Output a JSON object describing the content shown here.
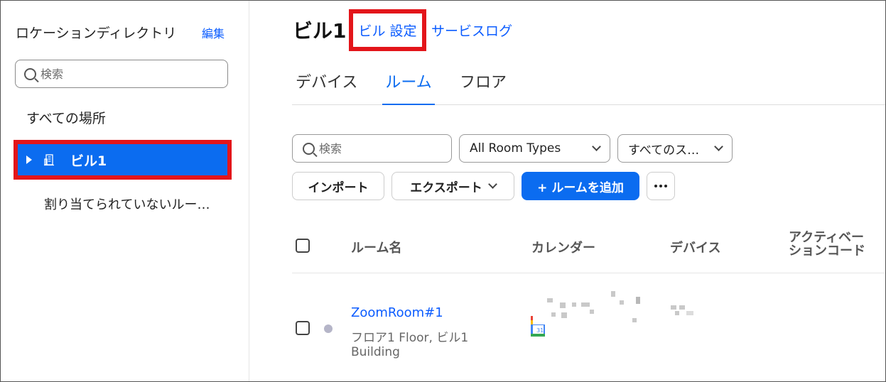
{
  "sidebar": {
    "title": "ロケーションディレクトリ",
    "edit_label": "編集",
    "search_placeholder": "検索",
    "all_locations": "すべての場所",
    "building_label": "ビル1",
    "unassigned": "割り当てられていないルー…"
  },
  "header": {
    "title": "ビル1",
    "settings_link": "ビル 設定",
    "service_log": "サービスログ"
  },
  "tabs": [
    {
      "label": "デバイス",
      "active": false
    },
    {
      "label": "ルーム",
      "active": true
    },
    {
      "label": "フロア",
      "active": false
    }
  ],
  "filters": {
    "search_placeholder": "検索",
    "room_types": "All Room Types",
    "status": "すべてのス…"
  },
  "actions": {
    "import": "インポート",
    "export": "エクスポート",
    "add_room": "+ ルームを追加"
  },
  "table": {
    "columns": [
      "ルーム名",
      "カレンダー",
      "デバイス",
      "アクティベー\nションコード"
    ],
    "rows": [
      {
        "name": "ZoomRoom#1",
        "location": "フロア1 Floor, ビル1 Building"
      }
    ]
  },
  "colors": {
    "accent": "#0b6cf0",
    "highlight": "#e3151a"
  }
}
